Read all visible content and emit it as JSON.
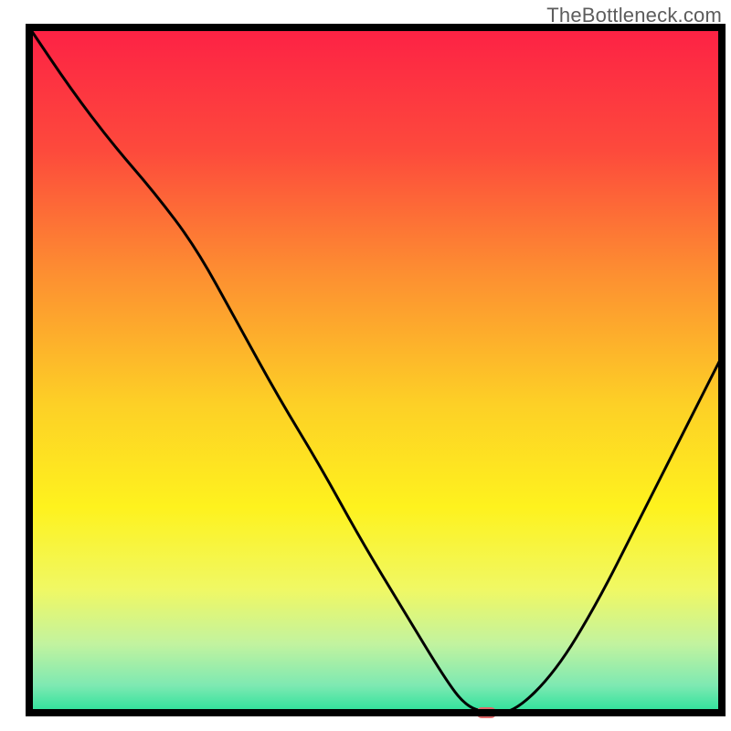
{
  "watermark": "TheBottleneck.com",
  "chart_data": {
    "type": "line",
    "title": "",
    "xlabel": "",
    "ylabel": "",
    "xlim": [
      0,
      100
    ],
    "ylim": [
      0,
      100
    ],
    "x": [
      0,
      6,
      12,
      18,
      24,
      30,
      36,
      42,
      48,
      54,
      60,
      63,
      66,
      70,
      76,
      82,
      88,
      94,
      100
    ],
    "values": [
      100,
      91,
      83,
      76,
      68,
      57,
      46,
      36,
      25,
      15,
      5,
      1,
      0,
      0,
      6,
      16,
      28,
      40,
      52
    ],
    "marker": {
      "x": 66,
      "y": 0,
      "color": "#e16a6a"
    },
    "background": {
      "type": "vertical-gradient",
      "stops": [
        {
          "pos": 0.0,
          "color": "#fd2145"
        },
        {
          "pos": 0.18,
          "color": "#fd4a3c"
        },
        {
          "pos": 0.36,
          "color": "#fd8f31"
        },
        {
          "pos": 0.55,
          "color": "#fdd026"
        },
        {
          "pos": 0.7,
          "color": "#fef21e"
        },
        {
          "pos": 0.82,
          "color": "#f0f864"
        },
        {
          "pos": 0.9,
          "color": "#c2f39f"
        },
        {
          "pos": 0.96,
          "color": "#7ee9b2"
        },
        {
          "pos": 1.0,
          "color": "#2ae19a"
        }
      ]
    },
    "axis_color": "#000000",
    "line_color": "#000000"
  }
}
